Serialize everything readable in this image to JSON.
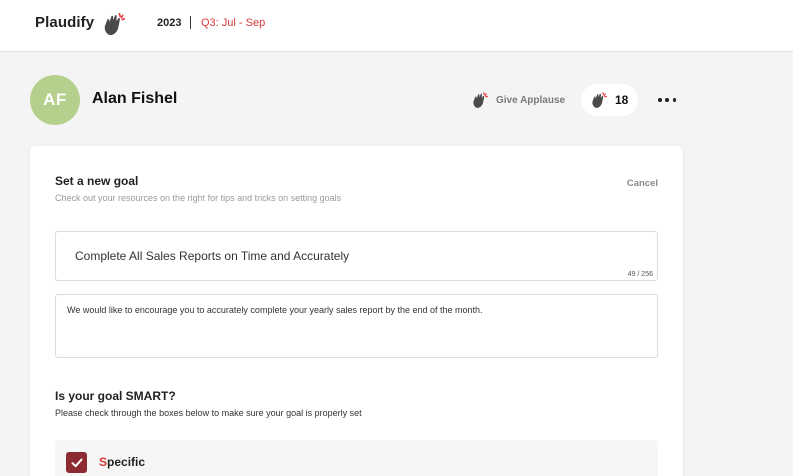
{
  "header": {
    "brand": "Plaudify",
    "year": "2023",
    "quarter": "Q3: Jul - Sep"
  },
  "profile": {
    "initials": "AF",
    "name": "Alan Fishel",
    "avatar_color": "#b5cf8c"
  },
  "actions": {
    "give_applause_label": "Give Applause",
    "applause_count": "18",
    "icons": [
      "clap-icon",
      "more-options-icon"
    ]
  },
  "goal_form": {
    "title": "Set a new goal",
    "subtitle": "Check out your resources on the right for tips and tricks on setting goals",
    "cancel_label": "Cancel",
    "goal_title_value": "Complete All Sales Reports on Time and Accurately",
    "goal_char_count": "49 / 256",
    "goal_description_value": "We would like to encourage you to accurately complete your yearly sales report by the end of the month."
  },
  "smart": {
    "title": "Is your goal SMART?",
    "subtitle": "Please check through the boxes below to make sure your goal is properly set",
    "items": [
      {
        "first_letter": "S",
        "rest": "pecific",
        "checked": true
      }
    ]
  },
  "colors": {
    "accent_red": "#d9383a",
    "checkbox_fill": "#8b2a30"
  }
}
